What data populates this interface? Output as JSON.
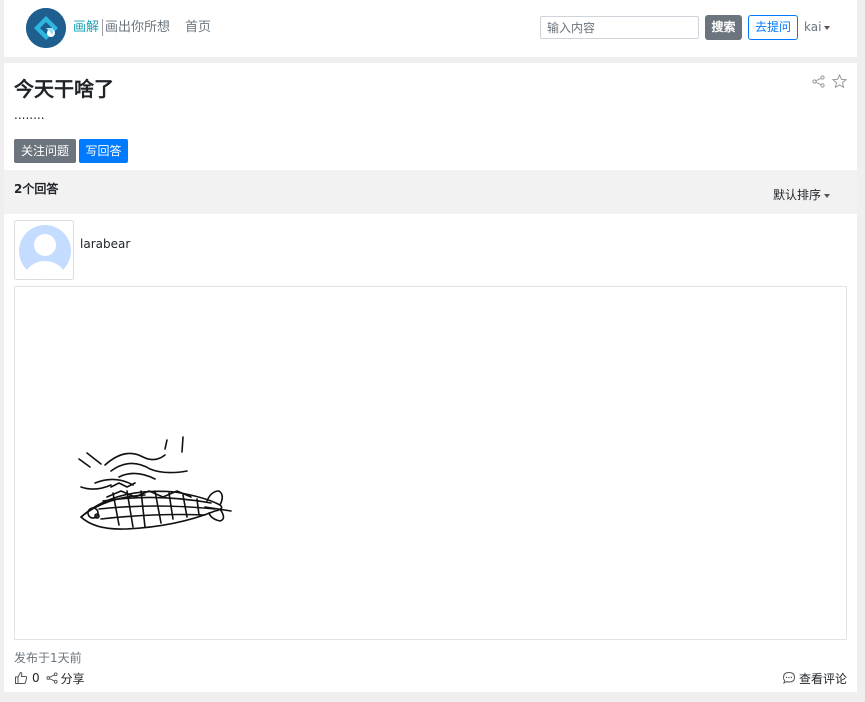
{
  "header": {
    "brand": "画解",
    "slogan": "画出你所想",
    "nav_home": "首页",
    "search_placeholder": "输入内容",
    "search_button": "搜索",
    "ask_button": "去提问",
    "username": "kai",
    "brand_color": "#17a2b8",
    "logo_icon": "house-logo-icon"
  },
  "question": {
    "title": "今天干啥了",
    "description": "........",
    "follow_button": "关注问题",
    "write_answer_button": "写回答",
    "share_icon": "share-icon",
    "favorite_icon": "star-icon"
  },
  "answers_header": {
    "count_label": "2个回答",
    "sort_label": "默认排序"
  },
  "answer": {
    "author": "larabear",
    "posted": "发布于1天前",
    "likes": "0",
    "share": "分享",
    "comments": "查看评论",
    "drawing_icon": "sketch-fish-drawing"
  },
  "colors": {
    "primary": "#007bff",
    "secondary": "#6c757d",
    "accent": "#17a2b8"
  }
}
